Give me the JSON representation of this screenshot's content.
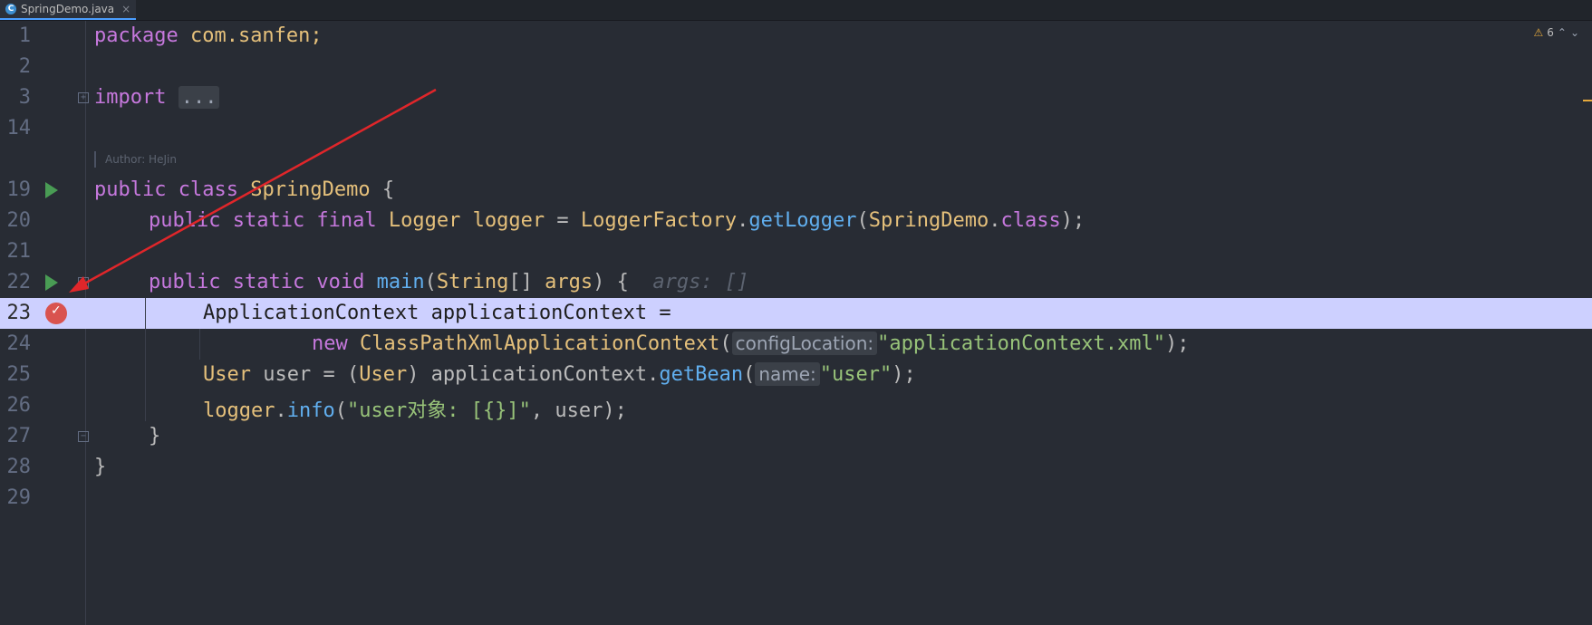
{
  "tab": {
    "icon": "java-class-icon",
    "filename": "SpringDemo.java",
    "close": "×"
  },
  "inspections": {
    "warning_count": "6",
    "warning_icon": "⚠",
    "up": "⌃",
    "down": "⌄"
  },
  "author_hint": "Author: HeJin",
  "lines": {
    "n1": "1",
    "n2": "2",
    "n3": "3",
    "n14": "14",
    "n19": "19",
    "n20": "20",
    "n21": "21",
    "n22": "22",
    "n23": "23",
    "n24": "24",
    "n25": "25",
    "n26": "26",
    "n27": "27",
    "n28": "28",
    "n29": "29"
  },
  "code": {
    "l1_kw": "package",
    "l1_rest": " com.sanfen;",
    "l3_kw": "import",
    "l3_fold": "...",
    "l19_kw": "public class",
    "l19_cls": "SpringDemo",
    "l19_rest": " {",
    "l20_kw": "public static final",
    "l20_cls": "Logger",
    "l20_var": "logger",
    "l20_eq": " = ",
    "l20_cls2": "LoggerFactory",
    "l20_dot": ".",
    "l20_fn": "getLogger",
    "l20_p1": "(",
    "l20_cls3": "SpringDemo",
    "l20_dot2": ".",
    "l20_kw2": "class",
    "l20_end": ");",
    "l22_kw": "public static void",
    "l22_fn": "main",
    "l22_p1": "(",
    "l22_cls": "String",
    "l22_arr": "[] ",
    "l22_arg": "args",
    "l22_end": ") {",
    "l22_hint": "args: []",
    "l23_text": "ApplicationContext applicationContext =",
    "l24_kw": "new",
    "l24_cls": "ClassPathXmlApplicationContext",
    "l24_p": "(",
    "l24_hint": "configLocation:",
    "l24_str": "\"applicationContext.xml\"",
    "l24_end": ");",
    "l25_cls": "User",
    "l25_var": " user = (",
    "l25_cls2": "User",
    "l25_rest": ") applicationContext.",
    "l25_fn": "getBean",
    "l25_p": "(",
    "l25_hint": "name:",
    "l25_str": "\"user\"",
    "l25_end": ");",
    "l26_fld": "logger",
    "l26_dot": ".",
    "l26_fn": "info",
    "l26_p": "(",
    "l26_str": "\"user对象: [{}]\"",
    "l26_end": ", user);",
    "l27": "}",
    "l28": "}"
  },
  "colors": {
    "background": "#282c34",
    "highlight_line": "#cdd0ff",
    "keyword": "#c678dd",
    "class": "#e5c07b",
    "function": "#61afef",
    "string": "#98c379",
    "annotation_arrow": "#e0262a",
    "breakpoint": "#d9534f",
    "run": "#499c54"
  }
}
